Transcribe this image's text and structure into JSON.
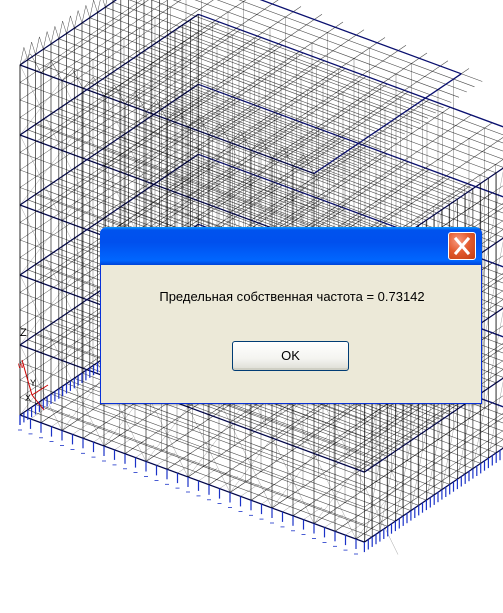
{
  "dialog": {
    "title": "",
    "message": "Предельная собственная частота = 0.73142",
    "ok_label": "OK"
  },
  "viewport": {
    "axis_labels": {
      "z": "Z",
      "y": "Y",
      "x": "X"
    }
  },
  "colors": {
    "frame_beam": "#000000",
    "frame_slab": "#0a1070",
    "support": "#1a32c8",
    "axis": "#cc0000",
    "titlebar": "#0055ea",
    "dialog_bg": "#ece9d8",
    "close_button": "#e35b2f"
  },
  "icons": {
    "close": "close-x-icon",
    "axes": "axis-triad-icon"
  }
}
